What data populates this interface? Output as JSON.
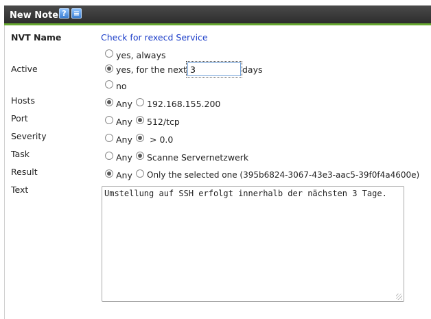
{
  "dialog": {
    "title": "New Note"
  },
  "fields": {
    "nvt_name_label": "NVT Name",
    "nvt_name_value": "Check for rexecd Service",
    "active_label": "Active",
    "active_yes_always": "yes, always",
    "active_yes_next": "yes, for the next",
    "active_days_value": "3",
    "active_days_unit": "days",
    "active_no": "no",
    "hosts_label": "Hosts",
    "hosts_any": "Any",
    "hosts_value": "192.168.155.200",
    "port_label": "Port",
    "port_any": "Any",
    "port_value": "512/tcp",
    "severity_label": "Severity",
    "severity_any": "Any",
    "severity_value": "> 0.0",
    "task_label": "Task",
    "task_any": "Any",
    "task_value": "Scanne Servernetzwerk",
    "result_label": "Result",
    "result_any": "Any",
    "result_value": "Only the selected one (395b6824-3067-43e3-aac5-39f0f4a4600e)",
    "text_label": "Text",
    "text_value": "Umstellung auf SSH erfolgt innerhalb der nächsten 3 Tage."
  },
  "selected": {
    "active": "yes, for the next",
    "hosts": "Any",
    "port": "512/tcp",
    "severity": "> 0.0",
    "task": "Scanne Servernetzwerk",
    "result": "Any"
  },
  "icons": {
    "help": "help-icon",
    "list": "list-icon"
  },
  "colors": {
    "title_bar": "#3a3a3a",
    "accent": "#67a82f",
    "link": "#1a3cc8"
  }
}
